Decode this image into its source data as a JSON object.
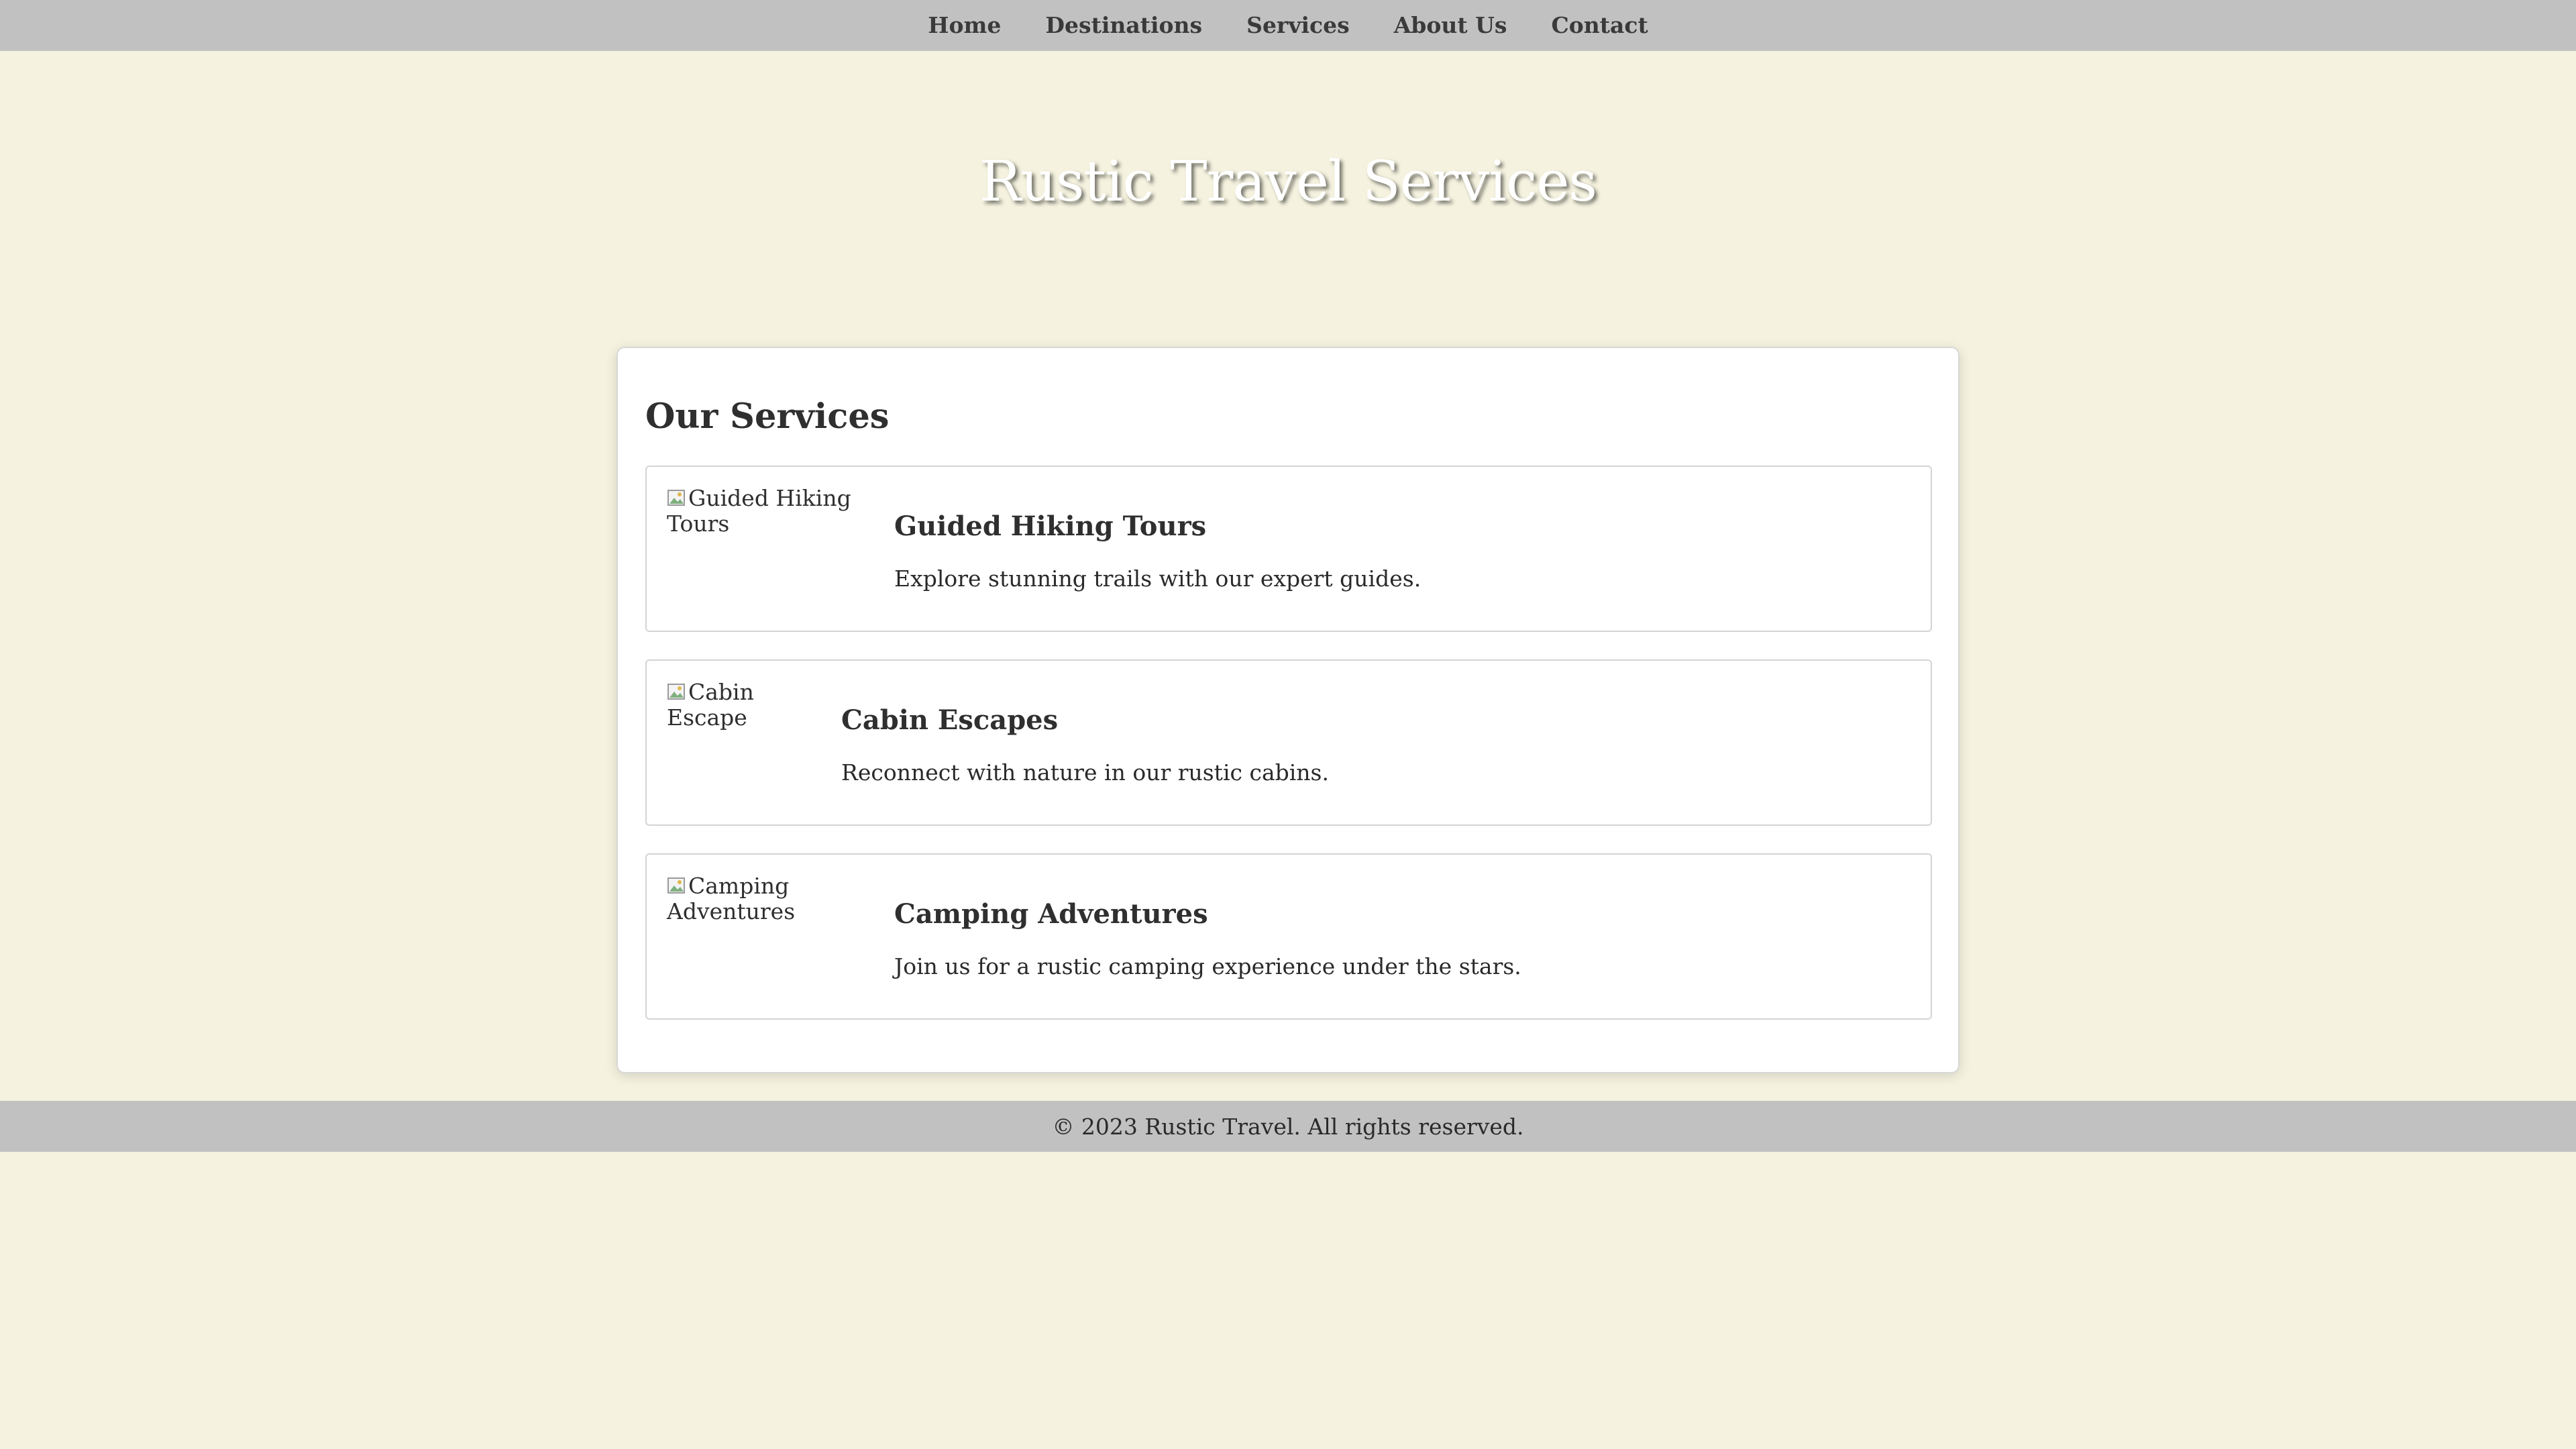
{
  "nav": {
    "items": [
      {
        "label": "Home"
      },
      {
        "label": "Destinations"
      },
      {
        "label": "Services"
      },
      {
        "label": "About Us"
      },
      {
        "label": "Contact"
      }
    ]
  },
  "header": {
    "title": "Rustic Travel Services"
  },
  "services": {
    "heading": "Our Services",
    "items": [
      {
        "img_alt": "Guided Hiking Tours",
        "title": "Guided Hiking Tours",
        "description": "Explore stunning trails with our expert guides."
      },
      {
        "img_alt": "Cabin Escape",
        "title": "Cabin Escapes",
        "description": "Reconnect with nature in our rustic cabins."
      },
      {
        "img_alt": "Camping Adventures",
        "title": "Camping Adventures",
        "description": "Join us for a rustic camping experience under the stars."
      }
    ]
  },
  "footer": {
    "text": "© 2023 Rustic Travel. All rights reserved."
  },
  "colors": {
    "background": "#f5f3df",
    "navbar": "#c1c1c1",
    "card": "#ffffff",
    "text": "#2f2f2f"
  },
  "icons": {
    "broken_image": "broken-image-icon"
  }
}
